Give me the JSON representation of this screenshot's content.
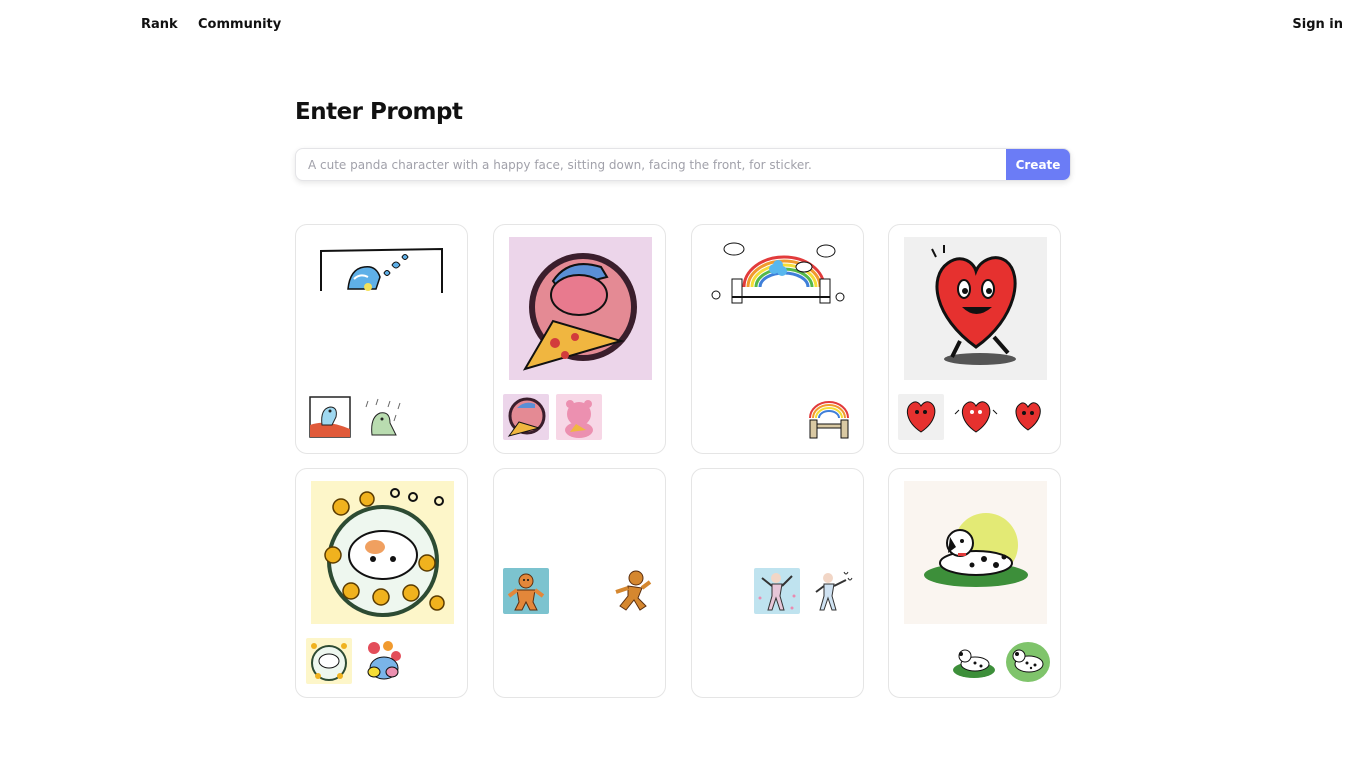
{
  "nav": {
    "links": [
      "Rank",
      "Community"
    ],
    "signin": "Sign in"
  },
  "main": {
    "heading": "Enter Prompt",
    "prompt_placeholder": "A cute panda character with a happy face, sitting down, facing the front, for sticker.",
    "create_label": "Create"
  },
  "colors": {
    "accent": "#6b7cf6",
    "card_border": "#e5e5e5",
    "placeholder_text": "#a1a1aa"
  },
  "gallery": {
    "cards": [
      {
        "main": "wave-sketch",
        "thumbs": [
          "dino-wave",
          "rain-dino"
        ]
      },
      {
        "main": "pizza-bear",
        "thumbs": [
          "pizza-bear",
          "pink-bear"
        ]
      },
      {
        "main": "rainbow-bridge",
        "thumbs": [
          "rainbow-bridge"
        ]
      },
      {
        "main": "walking-heart",
        "thumbs": [
          "heart-a",
          "heart-b",
          "heart-c"
        ]
      },
      {
        "main": "flower-cat",
        "thumbs": [
          "flower-cat",
          "flower-bee"
        ]
      },
      {
        "main": "",
        "thumbs": [
          "gingerbread-a",
          "gingerbread-b"
        ]
      },
      {
        "main": "",
        "thumbs": [
          "dancer-a",
          "dancer-b"
        ]
      },
      {
        "main": "dalmatian",
        "thumbs": [
          "dalmatian-a",
          "dalmatian-b"
        ]
      }
    ]
  }
}
